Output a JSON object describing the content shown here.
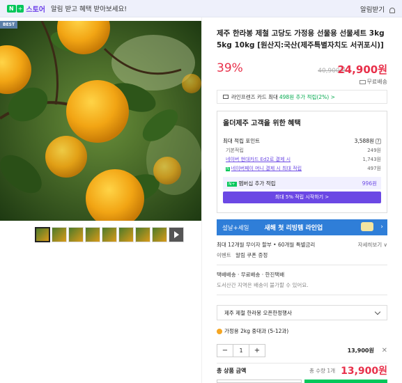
{
  "topbar": {
    "brand_n": "N",
    "brand_plus": "+",
    "brand_label": "스토어",
    "message": "알림 받고 혜택 받아보세요!",
    "alarm_button": "알림받기"
  },
  "gallery": {
    "badge": "BEST"
  },
  "product": {
    "title": "제주 한라봉 제철 고당도 가정용 선물용 선물세트 3kg 5kg 10kg [원산지:국산(제주특별자치도 서귀포시)]",
    "discount": "39%",
    "original_price": "40,900원",
    "sale_price": "24,900원",
    "shipping": "무료배송"
  },
  "card_banner": {
    "text": "라인프렌즈 카드 최대",
    "highlight": "498원 추가 적립(2%) >"
  },
  "benefits": {
    "title": "올더제주 고객을 위한 혜택",
    "max_points_label": "최대 적립 포인트",
    "max_points_value": "3,588원",
    "basic_label": "기본적립",
    "basic_value": "249원",
    "hyundai_label": "네이버 현대카드 Ed2로 결제 시",
    "hyundai_value": "1,743원",
    "money_label": "네이버페이 머니 결제 시 최대 적립",
    "money_value": "497원",
    "member_label": "멤버십 추가 적립",
    "member_value": "996원",
    "member_button": "최대 5% 적립 시작하기 >"
  },
  "promo": {
    "left": "설날+세일",
    "main": "새해 첫 리빙템 라인업"
  },
  "installment": {
    "text": "최대 12개월 무이자 할부 • 60개월 특별금리",
    "more": "자세히보기 ∨"
  },
  "event": {
    "tag": "이벤트",
    "text": "알림 쿠폰 증정"
  },
  "ship_info": {
    "line1": "택배배송 · 무료배송 · 한진택배",
    "line2": "도서산간 지역은 배송이 불가할 수 있어요."
  },
  "select": {
    "value": "제주 제철 한라봉 오픈한정행사"
  },
  "option": {
    "text": "가정용 2kg 중대과 (5-12과)"
  },
  "quantity": {
    "minus": "−",
    "value": "1",
    "plus": "+",
    "price": "13,900원",
    "remove": "✕"
  },
  "total": {
    "label": "총 상품 금액",
    "count": "총 수량 1개",
    "price": "13,900원"
  }
}
